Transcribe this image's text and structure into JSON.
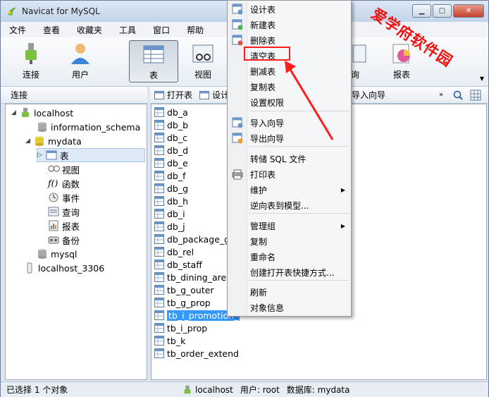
{
  "window": {
    "title": "Navicat for MySQL"
  },
  "menubar": [
    "文件",
    "查看",
    "收藏夹",
    "工具",
    "窗口",
    "帮助"
  ],
  "toolbar": [
    {
      "label": "连接",
      "icon": "plug-icon"
    },
    {
      "label": "用户",
      "icon": "user-icon"
    },
    {
      "label": "表",
      "icon": "table-icon",
      "active": true
    },
    {
      "label": "视图",
      "icon": "view-icon"
    },
    {
      "label": "询",
      "icon": "query-icon"
    },
    {
      "label": "报表",
      "icon": "report-icon"
    }
  ],
  "subheader": {
    "left": "连接",
    "actions": [
      "打开表",
      "设计表"
    ],
    "right_action": "导入向导"
  },
  "tree": {
    "connections": [
      {
        "label": "localhost"
      },
      {
        "label": "information_schema"
      },
      {
        "label": "mydata"
      },
      {
        "label": "表"
      },
      {
        "label": "视图"
      },
      {
        "label": "函数"
      },
      {
        "label": "事件"
      },
      {
        "label": "查询"
      },
      {
        "label": "报表"
      },
      {
        "label": "备份"
      },
      {
        "label": "mysql"
      },
      {
        "label": "localhost_3306"
      }
    ]
  },
  "tables": [
    "db_a",
    "db_b",
    "db_c",
    "db_d",
    "db_e",
    "db_f",
    "db_g",
    "db_h",
    "db_i",
    "db_j",
    "db_package_gc",
    "db_rel",
    "db_staff",
    "tb_dining_area",
    "tb_g_outer",
    "tb_g_prop",
    "tb_i_promotion_",
    "tb_i_prop",
    "tb_k",
    "tb_order_extend"
  ],
  "context_menu": {
    "items": [
      "设计表",
      "新建表",
      "删除表",
      "清空表",
      "删减表",
      "复制表",
      "设置权限",
      "导入向导",
      "导出向导",
      "转储 SQL 文件",
      "打印表",
      "维护",
      "逆向表到模型...",
      "管理组",
      "复制",
      "重命名",
      "创建打开表快捷方式...",
      "刷新",
      "对象信息"
    ]
  },
  "statusbar": {
    "selection": "已选择 1 个对象",
    "host": "localhost",
    "user": "用户: root",
    "db": "数据库: mydata"
  },
  "annotation": {
    "watermark": "爱学府软件园"
  },
  "colors": {
    "accent_red": "#ff1d1d",
    "selection": "#3399ff"
  }
}
